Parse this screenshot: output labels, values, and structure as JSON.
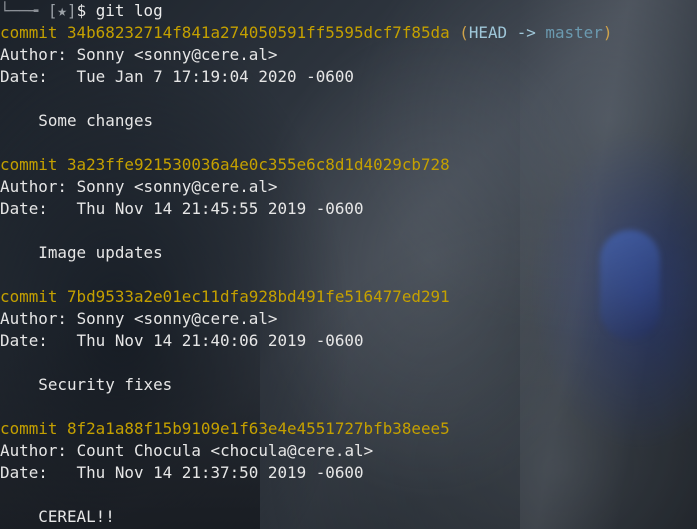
{
  "prompt": {
    "corner": "└──╼",
    "user_box": "[★]",
    "symbol": "$",
    "command": "git log"
  },
  "commits": [
    {
      "keyword": "commit",
      "hash": "34b68232714f841a274050591ff5595dcf7f85da",
      "refs": {
        "open": "(",
        "head": "HEAD",
        "arrow": "->",
        "branch": "master",
        "close": ")"
      },
      "author_label": "Author:",
      "author": "Sonny <sonny@cere.al>",
      "date_label": "Date:",
      "date": "Tue Jan 7 17:19:04 2020 -0600",
      "message": "Some changes"
    },
    {
      "keyword": "commit",
      "hash": "3a23ffe921530036a4e0c355e6c8d1d4029cb728",
      "author_label": "Author:",
      "author": "Sonny <sonny@cere.al>",
      "date_label": "Date:",
      "date": "Thu Nov 14 21:45:55 2019 -0600",
      "message": "Image updates"
    },
    {
      "keyword": "commit",
      "hash": "7bd9533a2e01ec11dfa928bd491fe516477ed291",
      "author_label": "Author:",
      "author": "Sonny <sonny@cere.al>",
      "date_label": "Date:",
      "date": "Thu Nov 14 21:40:06 2019 -0600",
      "message": "Security fixes"
    },
    {
      "keyword": "commit",
      "hash": "8f2a1a88f15b9109e1f63e4e4551727bfb38eee5",
      "author_label": "Author:",
      "author": "Count Chocula <chocula@cere.al>",
      "date_label": "Date:",
      "date": "Thu Nov 14 21:37:50 2019 -0600",
      "message": "CEREAL!!"
    }
  ],
  "colors": {
    "commit_hash": "#c4a000",
    "head_ref": "#9fc7d9",
    "branch_ref": "#6b9ab0",
    "text": "#e6e6e6"
  }
}
